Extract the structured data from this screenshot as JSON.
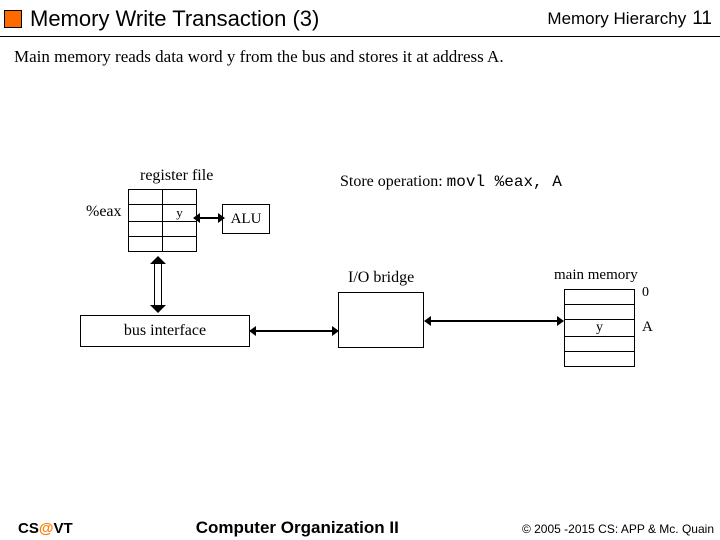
{
  "header": {
    "title_left": "Memory Write Transaction (3)",
    "title_right": "Memory Hierarchy",
    "page_number": "11"
  },
  "description": "Main memory reads data word y from the bus and stores it at address A.",
  "diagram": {
    "register_file_label": "register file",
    "eax_label": "%eax",
    "eax_value": "y",
    "alu_label": "ALU",
    "store_operation_prefix": "Store operation: ",
    "store_operation_code": "movl %eax, A",
    "bus_interface_label": "bus interface",
    "io_bridge_label": "I/O bridge",
    "main_memory_label": "main memory",
    "main_memory_index0": "0",
    "main_memory_value": "y",
    "main_memory_addr": "A"
  },
  "footer": {
    "cs": "CS",
    "at": "@",
    "vt": "VT",
    "center": "Computer Organization II",
    "right": "© 2005 -2015 CS: APP & Mc. Quain"
  }
}
